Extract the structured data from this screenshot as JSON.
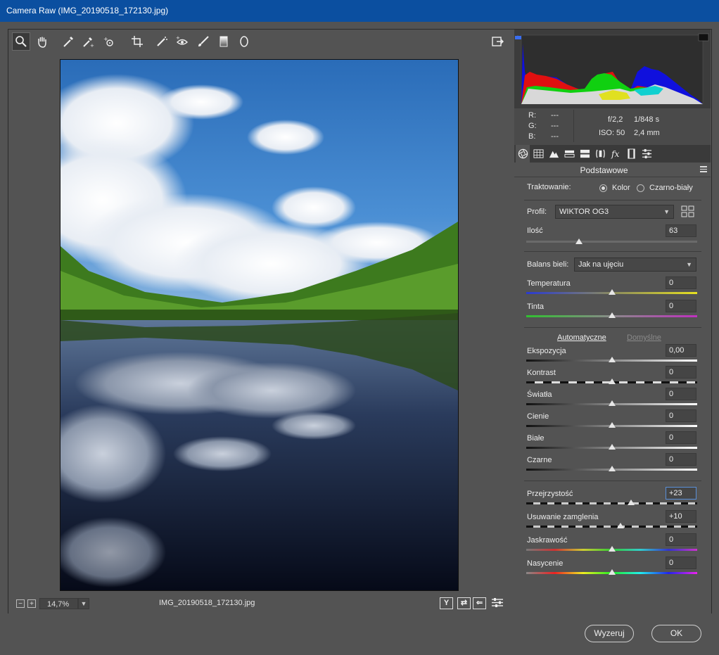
{
  "window": {
    "title": "Camera Raw (IMG_20190518_172130.jpg)"
  },
  "toolbar": {
    "tools": [
      "zoom-icon",
      "hand-icon",
      "white-balance-icon",
      "color-sampler-icon",
      "targeted-adjust-icon",
      "crop-icon",
      "spot-removal-icon",
      "red-eye-icon",
      "adjustment-brush-icon",
      "graduated-filter-icon",
      "radial-filter-icon"
    ],
    "open_prefs": "preferences-icon"
  },
  "bottom": {
    "zoom_out": "−",
    "zoom_in": "+",
    "zoom_value": "14,7%",
    "filename": "IMG_20190518_172130.jpg",
    "view_btn": "Y"
  },
  "histogram_info": {
    "r_label": "R:",
    "r_val": "---",
    "g_label": "G:",
    "g_val": "---",
    "b_label": "B:",
    "b_val": "---",
    "aperture": "f/2,2",
    "shutter": "1/848 s",
    "iso": "ISO: 50",
    "focal": "2,4 mm"
  },
  "panel": {
    "title": "Podstawowe",
    "treatment_label": "Traktowanie:",
    "treatment_color": "Kolor",
    "treatment_bw": "Czarno-biały",
    "profile_label": "Profil:",
    "profile_value": "WIKTOR OG3",
    "amount_label": "Ilość",
    "amount_value": "63",
    "amount_level": 0.31,
    "wb_label": "Balans bieli:",
    "wb_value": "Jak na ujęciu",
    "auto_label": "Automatyczne",
    "default_label": "Domyślne",
    "sliders": [
      {
        "key": "temperatura",
        "label": "Temperatura",
        "value": "0",
        "level": 0.5
      },
      {
        "key": "tinta",
        "label": "Tinta",
        "value": "0",
        "level": 0.5
      },
      {
        "key": "ekspozycja",
        "label": "Ekspozycja",
        "value": "0,00",
        "level": 0.5
      },
      {
        "key": "kontrast",
        "label": "Kontrast",
        "value": "0",
        "level": 0.5
      },
      {
        "key": "swiatla",
        "label": "Światła",
        "value": "0",
        "level": 0.5
      },
      {
        "key": "cienie",
        "label": "Cienie",
        "value": "0",
        "level": 0.5
      },
      {
        "key": "biale",
        "label": "Białe",
        "value": "0",
        "level": 0.5
      },
      {
        "key": "czarne",
        "label": "Czarne",
        "value": "0",
        "level": 0.5
      },
      {
        "key": "przejrzystosc",
        "label": "Przejrzystość",
        "value": "+23",
        "level": 0.615
      },
      {
        "key": "usuwanie",
        "label": "Usuwanie zamglenia",
        "value": "+10",
        "level": 0.55
      },
      {
        "key": "jaskrawosc",
        "label": "Jaskrawość",
        "value": "0",
        "level": 0.5
      },
      {
        "key": "nasycenie",
        "label": "Nasycenie",
        "value": "0",
        "level": 0.5
      }
    ]
  },
  "footer": {
    "reset": "Wyzeruj",
    "ok": "OK"
  },
  "colors": {
    "title_bar": "#0b4fa0",
    "panel_bg": "#535353",
    "focus": "#5a8fd8"
  }
}
